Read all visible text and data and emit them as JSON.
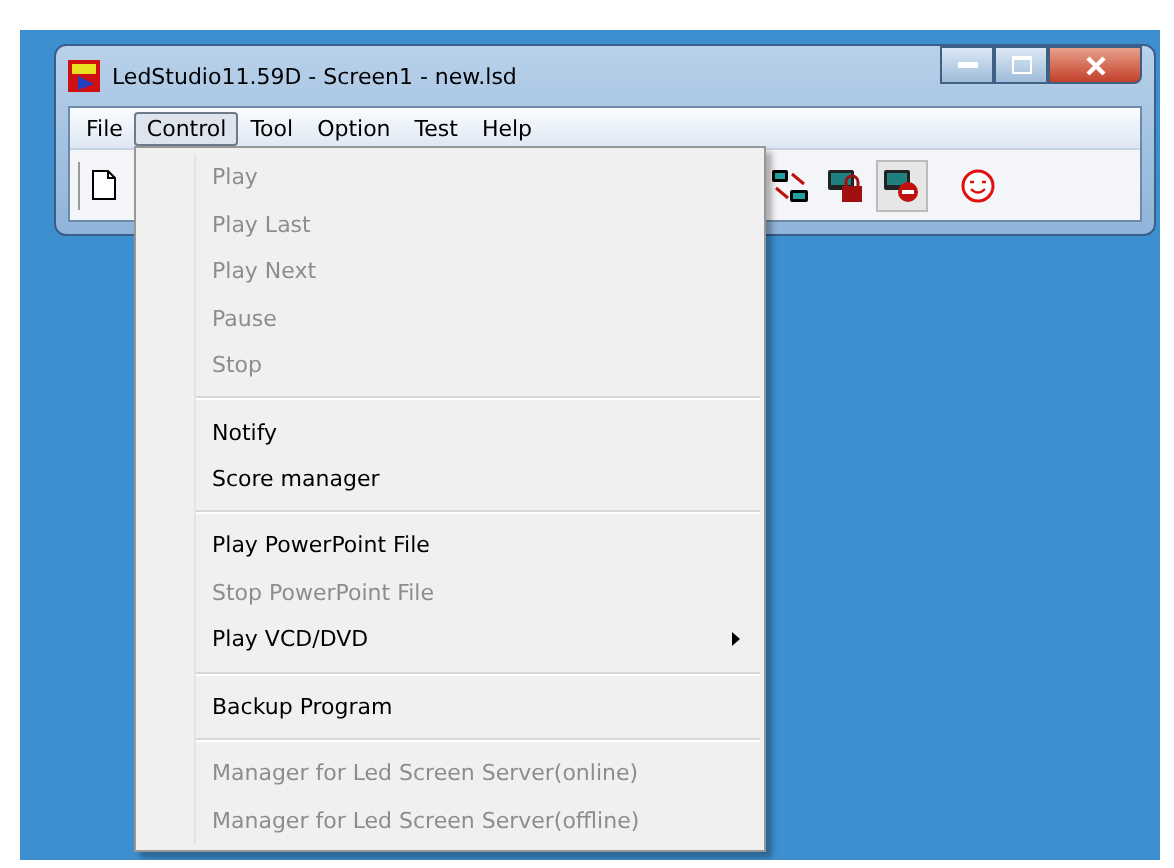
{
  "window": {
    "title": "LedStudio11.59D - Screen1 - new.lsd"
  },
  "menu_bar": [
    {
      "label": "File",
      "selected": false
    },
    {
      "label": "Control",
      "selected": true
    },
    {
      "label": "Tool",
      "selected": false
    },
    {
      "label": "Option",
      "selected": false
    },
    {
      "label": "Test",
      "selected": false
    },
    {
      "label": "Help",
      "selected": false
    }
  ],
  "control_menu": {
    "groups": [
      [
        {
          "label": "Play",
          "disabled": true,
          "submenu": false
        },
        {
          "label": "Play Last",
          "disabled": true,
          "submenu": false
        },
        {
          "label": "Play Next",
          "disabled": true,
          "submenu": false
        },
        {
          "label": "Pause",
          "disabled": true,
          "submenu": false
        },
        {
          "label": "Stop",
          "disabled": true,
          "submenu": false
        }
      ],
      [
        {
          "label": "Notify",
          "disabled": false,
          "submenu": false
        },
        {
          "label": "Score manager",
          "disabled": false,
          "submenu": false
        }
      ],
      [
        {
          "label": "Play PowerPoint File",
          "disabled": false,
          "submenu": false
        },
        {
          "label": "Stop PowerPoint File",
          "disabled": true,
          "submenu": false
        },
        {
          "label": "Play VCD/DVD",
          "disabled": false,
          "submenu": true
        }
      ],
      [
        {
          "label": "Backup Program",
          "disabled": false,
          "submenu": false
        }
      ],
      [
        {
          "label": "Manager for Led Screen Server(online)",
          "disabled": true,
          "submenu": false
        },
        {
          "label": "Manager for Led Screen Server(offline)",
          "disabled": true,
          "submenu": false
        }
      ]
    ]
  }
}
